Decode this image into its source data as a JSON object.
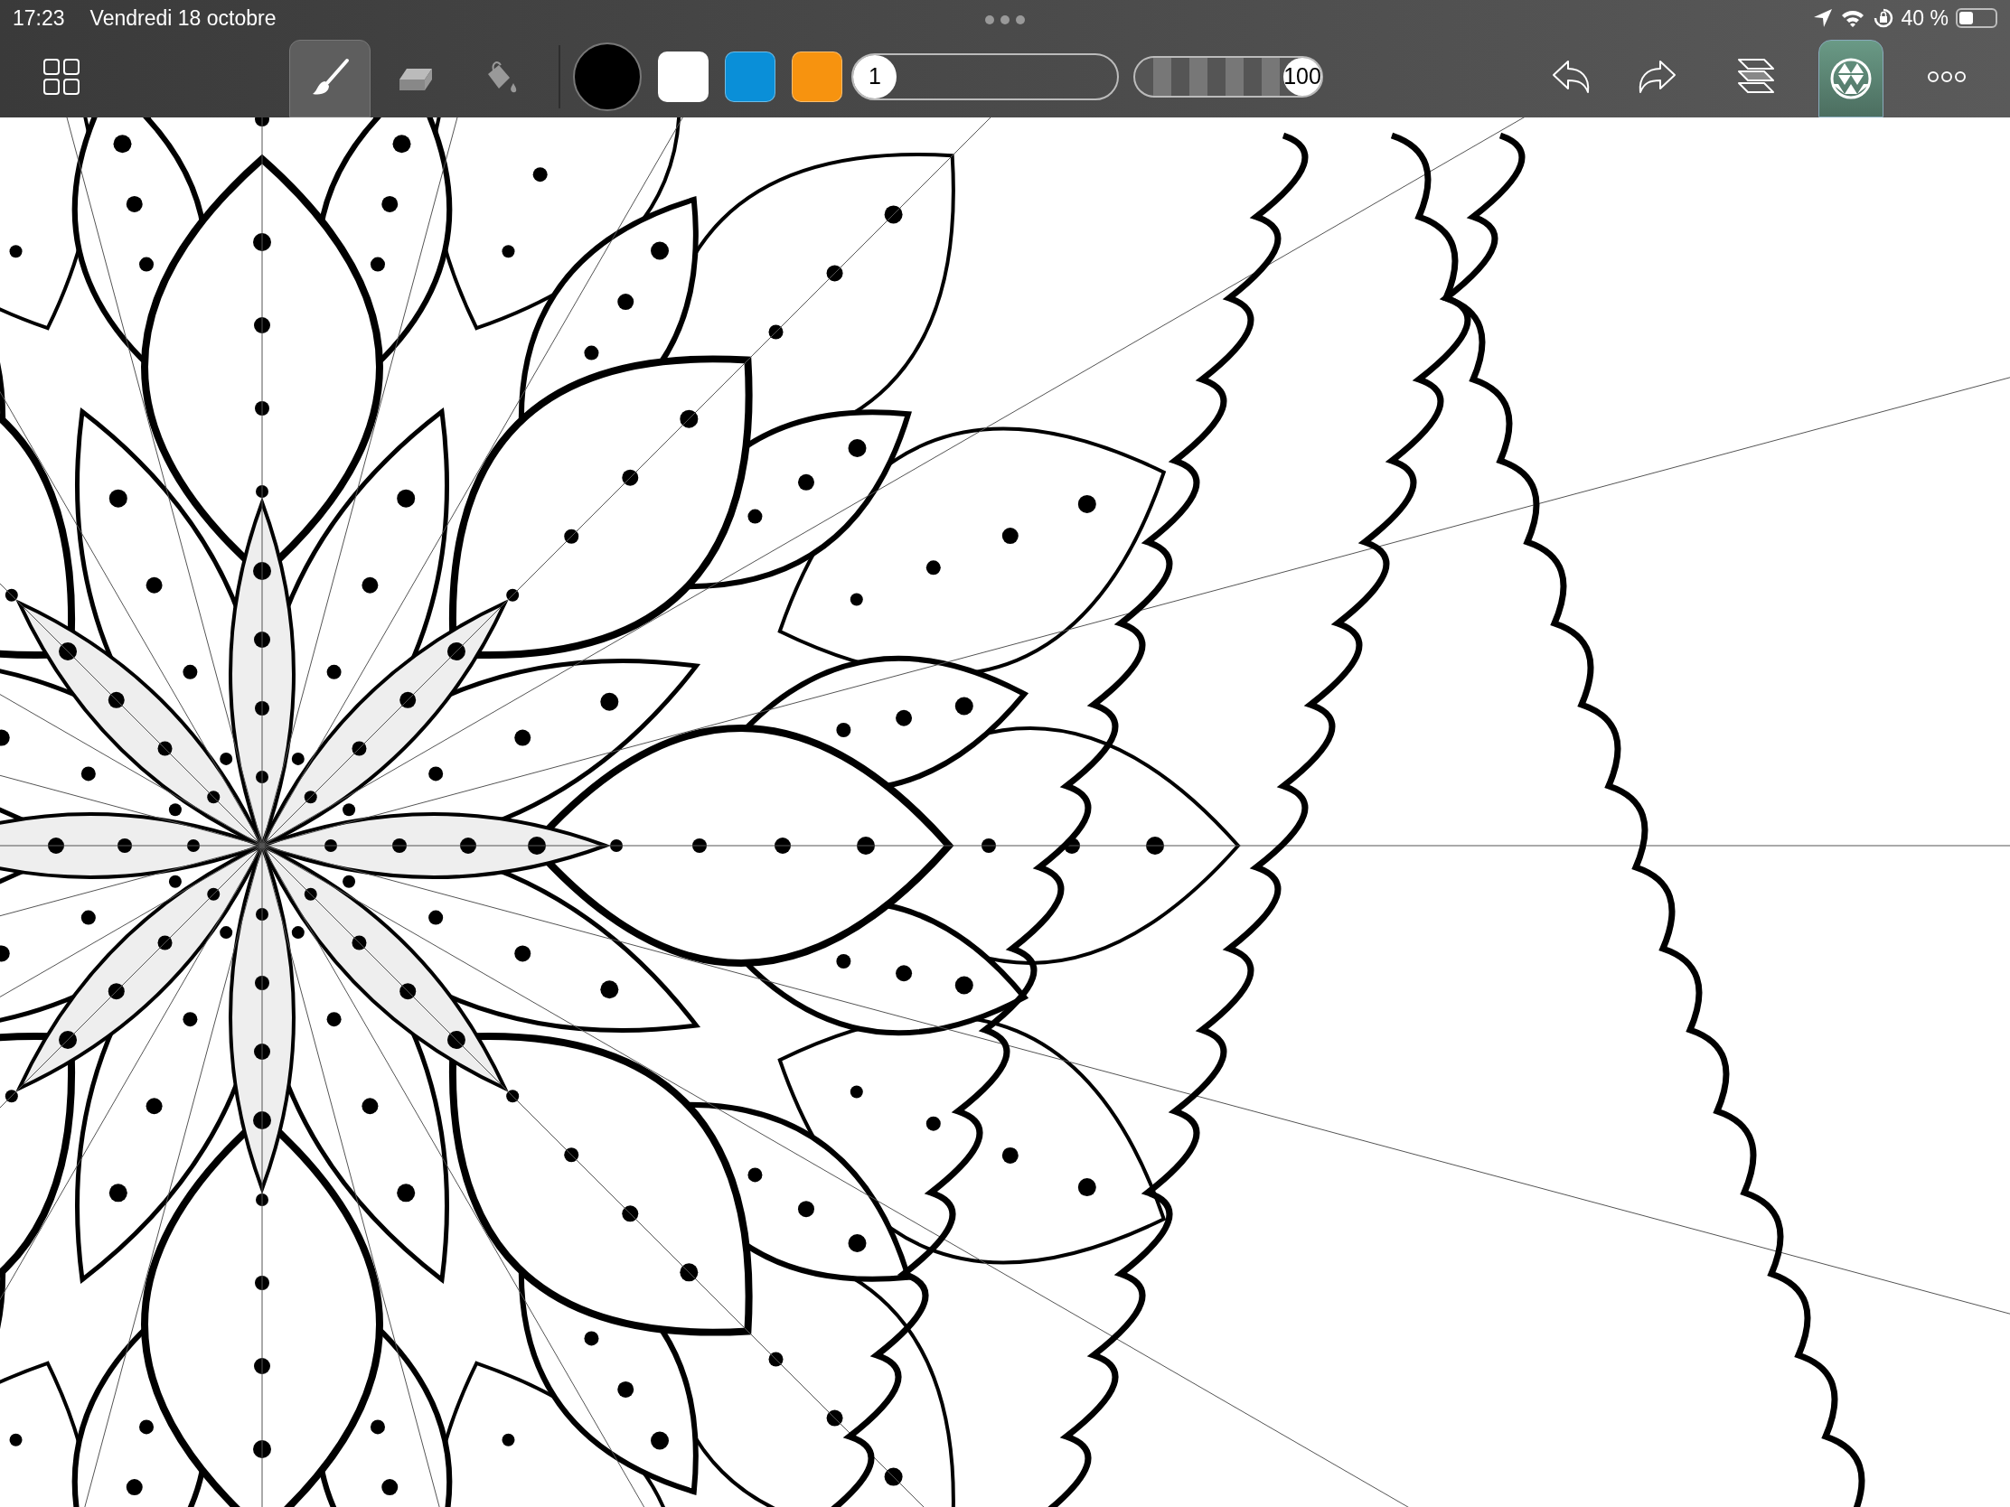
{
  "status_bar": {
    "time": "17:23",
    "date": "Vendredi 18 octobre",
    "battery": "40 %"
  },
  "tools": [
    {
      "kind": "brush",
      "selected": true
    },
    {
      "kind": "eraser",
      "selected": false
    },
    {
      "kind": "fill",
      "selected": false
    }
  ],
  "colors": [
    {
      "color": "#000000",
      "selected": true
    },
    {
      "color": "#ffffff",
      "selected": false
    },
    {
      "color": "#0a8fd8",
      "selected": false
    },
    {
      "color": "#f7930f",
      "selected": false
    }
  ],
  "brush_size": {
    "value": "1",
    "level": 0
  },
  "opacity": {
    "value": "100",
    "level": 1
  },
  "symmetry": {
    "on": true
  }
}
